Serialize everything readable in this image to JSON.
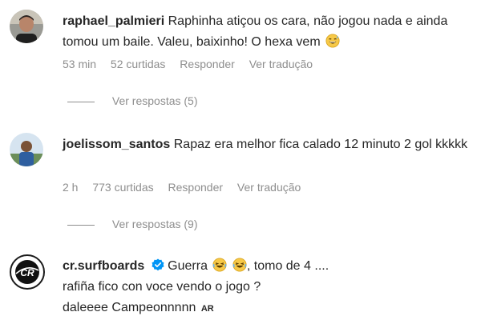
{
  "comments": [
    {
      "username": "raphael_palmieri",
      "text": "Raphinha atiçou os cara, não jogou nada e ainda tomou um baile. Valeu, baixinho! O hexa vem",
      "emoji": "grinning-sweat-emoji",
      "time": "53 min",
      "likes": "52 curtidas",
      "reply_label": "Responder",
      "translate_label": "Ver tradução",
      "view_replies": "Ver respostas (5)"
    },
    {
      "username": "joelissom_santos",
      "text": "Rapaz era melhor fica calado 12 minuto 2 gol kkkkk",
      "time": "2 h",
      "likes": "773 curtidas",
      "reply_label": "Responder",
      "translate_label": "Ver tradução",
      "view_replies": "Ver respostas (9)"
    },
    {
      "username": "cr.surfboards",
      "verified": true,
      "line1_a": "Guerra",
      "line1_b": ", tomo de 4 ....",
      "line2": "rafiña fico con voce vendo o jogo ?",
      "line3": "daleeee Campeonnnnn",
      "line3_tag": "AR",
      "avatar_logo": "CR"
    }
  ],
  "colors": {
    "text": "#262626",
    "meta": "#8e8e8e",
    "verified": "#0095f6"
  }
}
